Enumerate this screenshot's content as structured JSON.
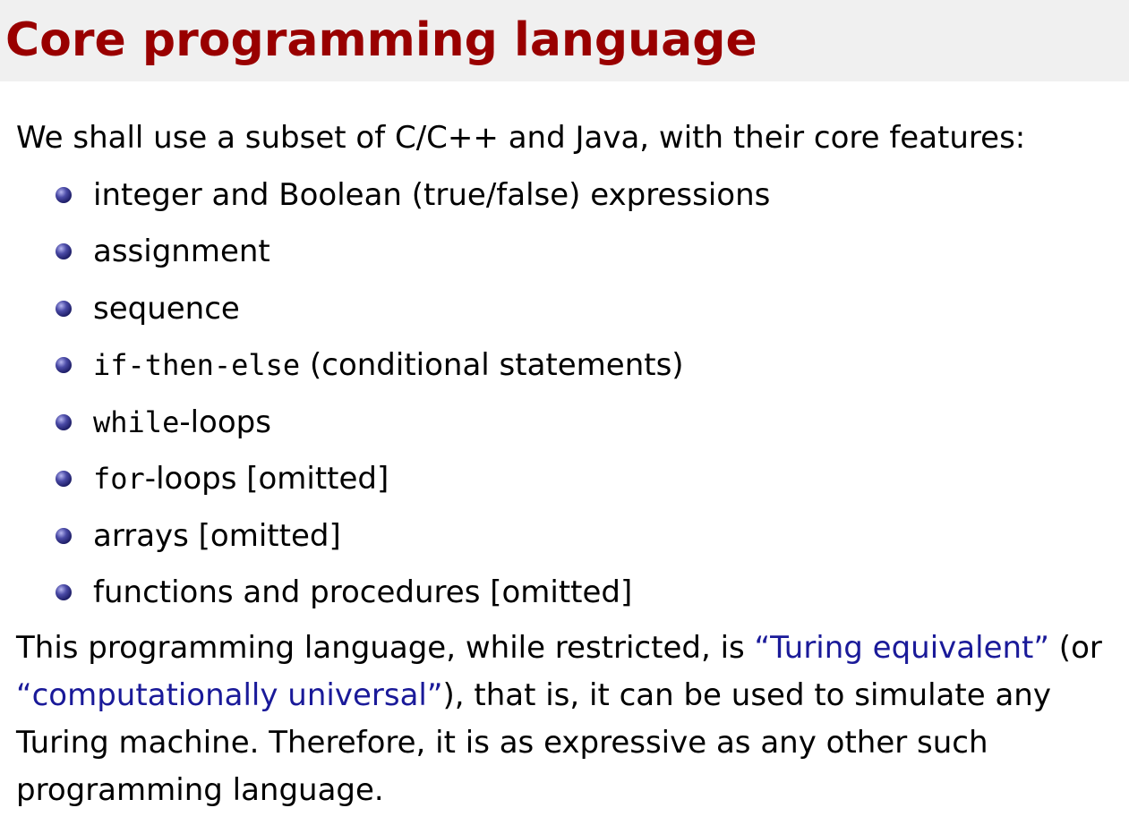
{
  "slide": {
    "title": "Core programming language",
    "intro": "We shall use a subset of C/C++ and Java, with their core features:",
    "bullets": [
      {
        "code": "",
        "text": "integer and Boolean (true/false) expressions"
      },
      {
        "code": "",
        "text": "assignment"
      },
      {
        "code": "",
        "text": "sequence"
      },
      {
        "code": "if-then-else",
        "text": " (conditional statements)"
      },
      {
        "code": "while",
        "text": "-loops"
      },
      {
        "code": "for",
        "text": "-loops [omitted]"
      },
      {
        "code": "",
        "text": "arrays [omitted]"
      },
      {
        "code": "",
        "text": "functions and procedures [omitted]"
      }
    ],
    "closing": {
      "part1": "This programming language, while restricted, is ",
      "term1": "“Turing equivalent”",
      "part2": " (or ",
      "term2": "“computationally universal”",
      "part3": "), that is, it can be used to simulate any Turing machine. Therefore, it is as expressive as any other such programming language."
    },
    "colors": {
      "title": "#990000",
      "title_bar": "#f0f0f0",
      "term": "#1a1a99",
      "bullet": "#2a2a80"
    }
  }
}
